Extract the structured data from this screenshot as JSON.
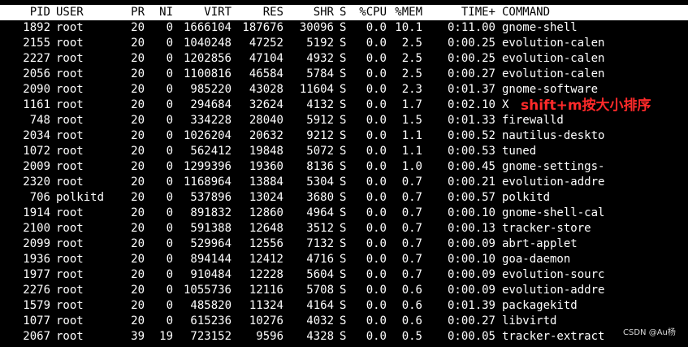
{
  "header": {
    "pid": "PID",
    "user": "USER",
    "pr": "PR",
    "ni": "NI",
    "virt": "VIRT",
    "res": "RES",
    "shr": "SHR",
    "s": "S",
    "cpu": "%CPU",
    "mem": "%MEM",
    "time": "TIME+",
    "command": "COMMAND"
  },
  "processes": [
    {
      "pid": "1892",
      "user": "root",
      "pr": "20",
      "ni": "0",
      "virt": "1666104",
      "res": "187676",
      "shr": "30096",
      "s": "S",
      "cpu": "0.0",
      "mem": "10.1",
      "time": "0:11.00",
      "command": "gnome-shell"
    },
    {
      "pid": "2155",
      "user": "root",
      "pr": "20",
      "ni": "0",
      "virt": "1040248",
      "res": "47252",
      "shr": "5192",
      "s": "S",
      "cpu": "0.0",
      "mem": "2.5",
      "time": "0:00.25",
      "command": "evolution-calen"
    },
    {
      "pid": "2227",
      "user": "root",
      "pr": "20",
      "ni": "0",
      "virt": "1202856",
      "res": "47104",
      "shr": "4932",
      "s": "S",
      "cpu": "0.0",
      "mem": "2.5",
      "time": "0:00.25",
      "command": "evolution-calen"
    },
    {
      "pid": "2056",
      "user": "root",
      "pr": "20",
      "ni": "0",
      "virt": "1100816",
      "res": "46584",
      "shr": "5784",
      "s": "S",
      "cpu": "0.0",
      "mem": "2.5",
      "time": "0:00.27",
      "command": "evolution-calen"
    },
    {
      "pid": "2090",
      "user": "root",
      "pr": "20",
      "ni": "0",
      "virt": "985220",
      "res": "43028",
      "shr": "11604",
      "s": "S",
      "cpu": "0.0",
      "mem": "2.3",
      "time": "0:01.37",
      "command": "gnome-software"
    },
    {
      "pid": "1161",
      "user": "root",
      "pr": "20",
      "ni": "0",
      "virt": "294684",
      "res": "32624",
      "shr": "4132",
      "s": "S",
      "cpu": "0.0",
      "mem": "1.7",
      "time": "0:02.10",
      "command": "X"
    },
    {
      "pid": "748",
      "user": "root",
      "pr": "20",
      "ni": "0",
      "virt": "334228",
      "res": "28040",
      "shr": "5912",
      "s": "S",
      "cpu": "0.0",
      "mem": "1.5",
      "time": "0:01.33",
      "command": "firewalld"
    },
    {
      "pid": "2034",
      "user": "root",
      "pr": "20",
      "ni": "0",
      "virt": "1026204",
      "res": "20632",
      "shr": "9212",
      "s": "S",
      "cpu": "0.0",
      "mem": "1.1",
      "time": "0:00.52",
      "command": "nautilus-deskto"
    },
    {
      "pid": "1072",
      "user": "root",
      "pr": "20",
      "ni": "0",
      "virt": "562412",
      "res": "19848",
      "shr": "5072",
      "s": "S",
      "cpu": "0.0",
      "mem": "1.1",
      "time": "0:00.53",
      "command": "tuned"
    },
    {
      "pid": "2009",
      "user": "root",
      "pr": "20",
      "ni": "0",
      "virt": "1299396",
      "res": "19360",
      "shr": "8136",
      "s": "S",
      "cpu": "0.0",
      "mem": "1.0",
      "time": "0:00.45",
      "command": "gnome-settings-"
    },
    {
      "pid": "2320",
      "user": "root",
      "pr": "20",
      "ni": "0",
      "virt": "1168964",
      "res": "13884",
      "shr": "5304",
      "s": "S",
      "cpu": "0.0",
      "mem": "0.7",
      "time": "0:00.21",
      "command": "evolution-addre"
    },
    {
      "pid": "706",
      "user": "polkitd",
      "pr": "20",
      "ni": "0",
      "virt": "537896",
      "res": "13024",
      "shr": "3680",
      "s": "S",
      "cpu": "0.0",
      "mem": "0.7",
      "time": "0:00.57",
      "command": "polkitd"
    },
    {
      "pid": "1914",
      "user": "root",
      "pr": "20",
      "ni": "0",
      "virt": "891832",
      "res": "12860",
      "shr": "4964",
      "s": "S",
      "cpu": "0.0",
      "mem": "0.7",
      "time": "0:00.10",
      "command": "gnome-shell-cal"
    },
    {
      "pid": "2100",
      "user": "root",
      "pr": "20",
      "ni": "0",
      "virt": "591388",
      "res": "12648",
      "shr": "3512",
      "s": "S",
      "cpu": "0.0",
      "mem": "0.7",
      "time": "0:00.13",
      "command": "tracker-store"
    },
    {
      "pid": "2099",
      "user": "root",
      "pr": "20",
      "ni": "0",
      "virt": "529964",
      "res": "12556",
      "shr": "7132",
      "s": "S",
      "cpu": "0.0",
      "mem": "0.7",
      "time": "0:00.09",
      "command": "abrt-applet"
    },
    {
      "pid": "1936",
      "user": "root",
      "pr": "20",
      "ni": "0",
      "virt": "894144",
      "res": "12412",
      "shr": "4716",
      "s": "S",
      "cpu": "0.0",
      "mem": "0.7",
      "time": "0:00.10",
      "command": "goa-daemon"
    },
    {
      "pid": "1977",
      "user": "root",
      "pr": "20",
      "ni": "0",
      "virt": "910484",
      "res": "12228",
      "shr": "5604",
      "s": "S",
      "cpu": "0.0",
      "mem": "0.7",
      "time": "0:00.09",
      "command": "evolution-sourc"
    },
    {
      "pid": "2276",
      "user": "root",
      "pr": "20",
      "ni": "0",
      "virt": "1055736",
      "res": "12116",
      "shr": "5708",
      "s": "S",
      "cpu": "0.0",
      "mem": "0.6",
      "time": "0:00.09",
      "command": "evolution-addre"
    },
    {
      "pid": "1579",
      "user": "root",
      "pr": "20",
      "ni": "0",
      "virt": "485820",
      "res": "11324",
      "shr": "4164",
      "s": "S",
      "cpu": "0.0",
      "mem": "0.6",
      "time": "0:01.39",
      "command": "packagekitd"
    },
    {
      "pid": "1077",
      "user": "root",
      "pr": "20",
      "ni": "0",
      "virt": "615236",
      "res": "10276",
      "shr": "4032",
      "s": "S",
      "cpu": "0.0",
      "mem": "0.6",
      "time": "0:00.27",
      "command": "libvirtd"
    },
    {
      "pid": "2067",
      "user": "root",
      "pr": "39",
      "ni": "19",
      "virt": "723152",
      "res": "9596",
      "shr": "4328",
      "s": "S",
      "cpu": "0.0",
      "mem": "0.5",
      "time": "0:00.05",
      "command": "tracker-extract"
    }
  ],
  "annotation": {
    "text": "shift+m按大小排序",
    "color": "#ff2a2a"
  },
  "watermark": {
    "text": "CSDN @Au杨"
  },
  "colors": {
    "background": "#000000",
    "foreground": "#ffffff",
    "header_background": "#ffffff",
    "header_foreground": "#000000"
  }
}
